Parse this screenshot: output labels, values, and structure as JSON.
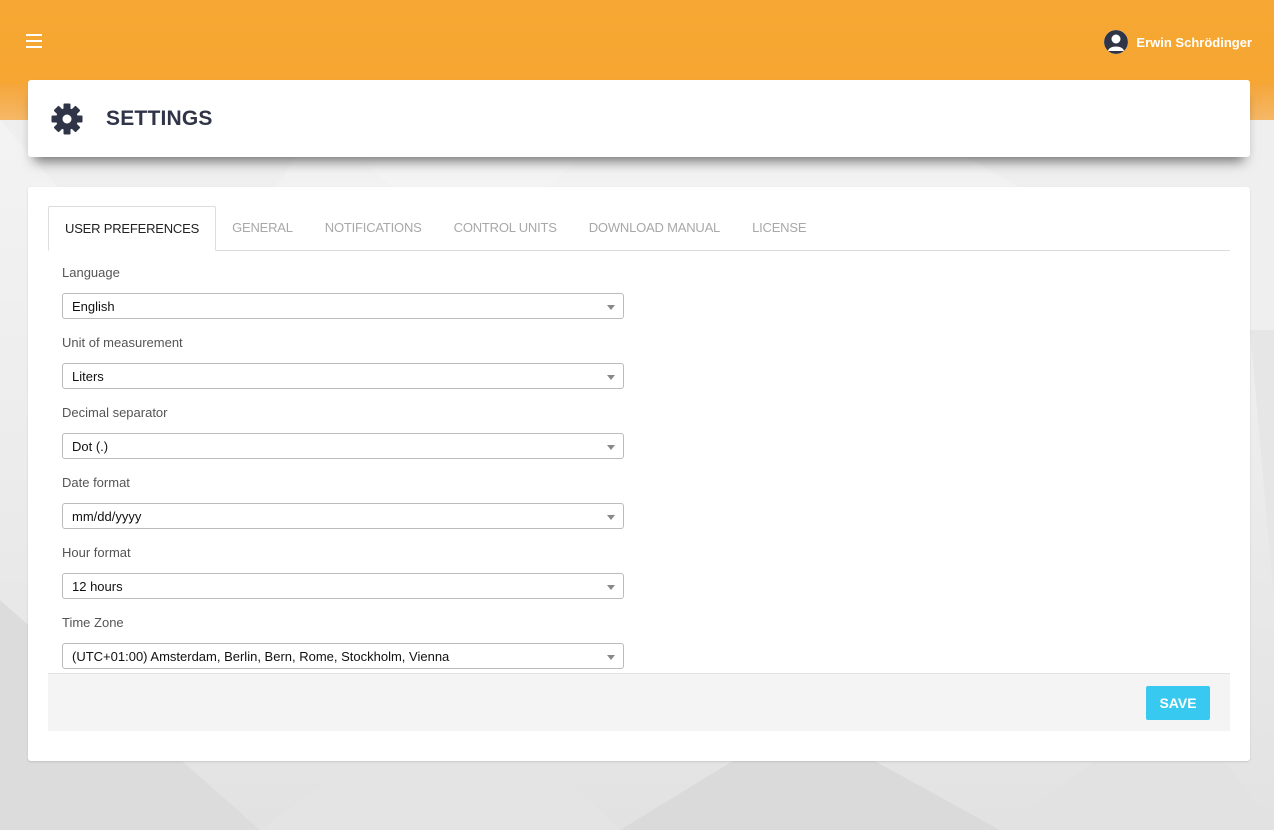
{
  "header": {
    "user_name": "Erwin Schrödinger",
    "menu_icon": "hamburger-menu-icon",
    "avatar_icon": "user-avatar-icon"
  },
  "page": {
    "title": "SETTINGS",
    "icon": "gear-icon"
  },
  "tabs": [
    {
      "label": "USER PREFERENCES",
      "active": true
    },
    {
      "label": "GENERAL",
      "active": false
    },
    {
      "label": "NOTIFICATIONS",
      "active": false
    },
    {
      "label": "CONTROL UNITS",
      "active": false
    },
    {
      "label": "DOWNLOAD MANUAL",
      "active": false
    },
    {
      "label": "LICENSE",
      "active": false
    }
  ],
  "form": {
    "fields": [
      {
        "label": "Language",
        "value": "English"
      },
      {
        "label": "Unit of measurement",
        "value": "Liters"
      },
      {
        "label": "Decimal separator",
        "value": "Dot (.)"
      },
      {
        "label": "Date format",
        "value": "mm/dd/yyyy"
      },
      {
        "label": "Hour format",
        "value": "12 hours"
      },
      {
        "label": "Time Zone",
        "value": "(UTC+01:00) Amsterdam, Berlin, Bern, Rome, Stockholm, Vienna"
      }
    ]
  },
  "footer": {
    "save_label": "SAVE"
  },
  "colors": {
    "header_orange": "#f7a834",
    "save_button": "#38c9f0",
    "title_text": "#2f3447"
  }
}
